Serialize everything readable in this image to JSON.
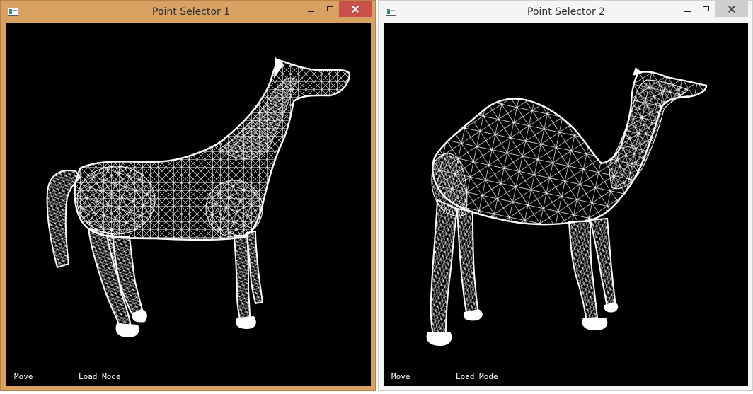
{
  "windows": [
    {
      "title": "Point Selector 1",
      "model": "horse-wireframe",
      "status": {
        "left": "Move",
        "right": "Load Mode"
      }
    },
    {
      "title": "Point Selector 2",
      "model": "camel-wireframe",
      "status": {
        "left": "Move",
        "right": "Load Mode"
      }
    }
  ],
  "colors": {
    "active_frame": "#d7a262",
    "inactive_frame": "#f5f5f5",
    "close_active": "#c7514a",
    "viewport_bg": "#000000",
    "wireframe": "#ffffff"
  }
}
